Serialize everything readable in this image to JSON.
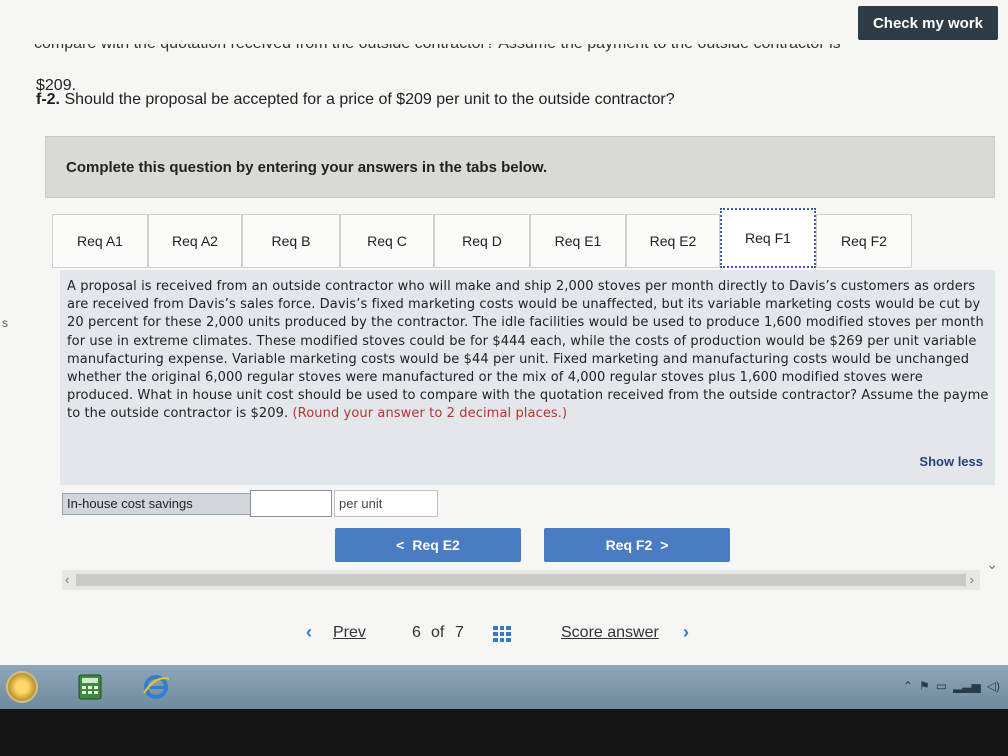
{
  "header": {
    "check_work_label": "Check my work"
  },
  "question": {
    "cut_line": "compare with the quotation received from the outside contractor? Assume the payment to the outside contractor is",
    "value_line": "$209.",
    "part_label": "f-2.",
    "part_text": "Should the proposal be accepted for a price of $209 per unit to the outside contractor?"
  },
  "instructions": "Complete this question by entering your answers in the tabs below.",
  "tabs": [
    {
      "label": "Req A1"
    },
    {
      "label": "Req A2"
    },
    {
      "label": "Req B"
    },
    {
      "label": "Req C"
    },
    {
      "label": "Req D"
    },
    {
      "label": "Req E1"
    },
    {
      "label": "Req E2"
    },
    {
      "label": "Req F1"
    },
    {
      "label": "Req F2"
    }
  ],
  "content": {
    "paragraph": "A proposal is received from an outside contractor who will make and ship 2,000 stoves per month directly to Davis’s customers as orders are received from Davis’s sales force. Davis’s fixed marketing costs would be unaffected, but its variable marketing costs would be cut by 20 percent for these 2,000 units produced by the contractor. The idle facilities would be used to produce 1,600 modified stoves per month for use in extreme climates. These modified stoves could be for $444 each, while the costs of production would be $269 per unit variable manufacturing expense. Variable marketing costs would be $44 per unit. Fixed marketing and manufacturing costs would be unchanged whether the original 6,000 regular stoves were manufactured or the mix of 4,000 regular stoves plus 1,600 modified stoves were produced. What in house unit cost should be used to compare with the quotation received from the outside contractor? Assume the payme to the outside contractor is $209.",
    "hint": "(Round your answer to 2 decimal places.)",
    "show_less": "Show less"
  },
  "answer": {
    "label": "In-house cost savings",
    "value": "",
    "unit": "per unit"
  },
  "nav": {
    "prev_req": "Req E2",
    "next_req": "Req F2",
    "prev_glyph": "<",
    "next_glyph": ">"
  },
  "pager": {
    "prev": "Prev",
    "current": "6",
    "of": "of",
    "total": "7",
    "score": "Score answer"
  },
  "colors": {
    "accent": "#4a7cc2",
    "dark_button": "#2f3b45",
    "hint_red": "#b83232",
    "link_blue": "#3a78c4"
  }
}
